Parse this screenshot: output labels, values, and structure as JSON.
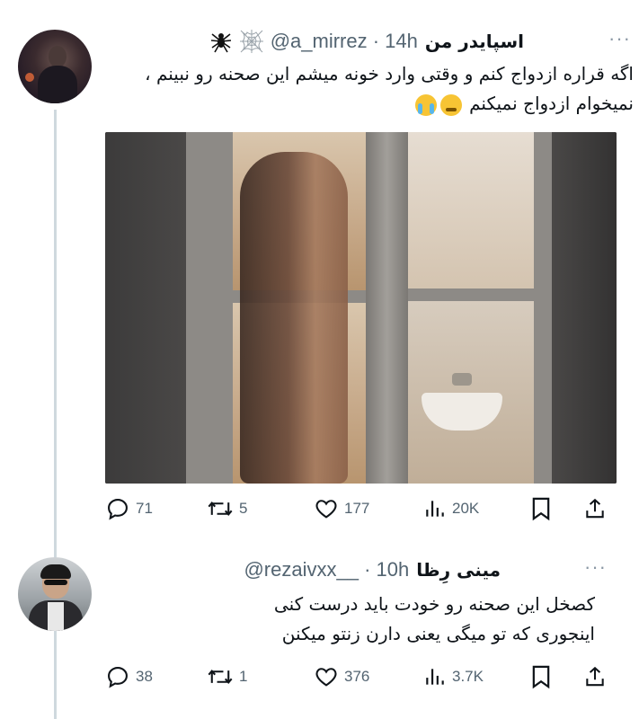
{
  "tweet": {
    "display_name": "اسپایدر من",
    "handle_time": "@a_mirrez · 14h",
    "text": "اگه قراره ازدواج کنم و وقتی وارد خونه میشم این صحنه رو نبینم ، نمیخوام ازدواج نمیکنم",
    "emoji_icons": [
      "spider-icon",
      "spiderweb-icon"
    ],
    "stats": {
      "replies": "71",
      "reposts": "5",
      "likes": "177",
      "views": "20K"
    }
  },
  "reply": {
    "display_name": "مینی رِظا",
    "handle_time": "@rezaivxx__ · 10h",
    "text_line1": "کصخل این صحنه رو خودت باید درست کنی",
    "text_line2": "اینجوری که تو میگی یعنی دارن زنتو میکنن",
    "stats": {
      "replies": "38",
      "reposts": "1",
      "likes": "376",
      "views": "3.7K"
    }
  },
  "colors": {
    "secondary_text": "#536471",
    "thread_line": "#cfd9de"
  }
}
